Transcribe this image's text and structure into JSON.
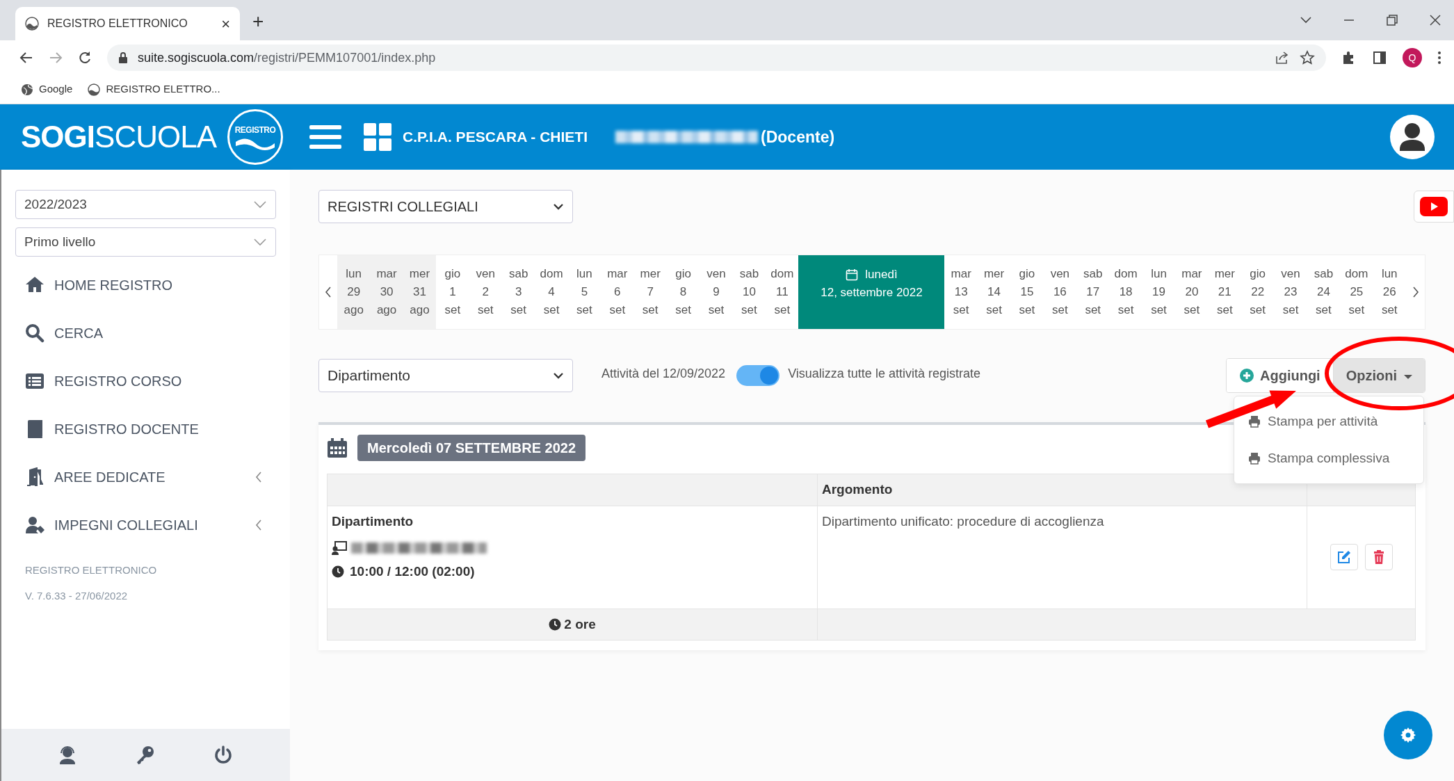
{
  "browser": {
    "tab_title": "REGISTRO ELETTRONICO",
    "tab_close": "×",
    "new_tab": "+",
    "url_host": "suite.sogiscuola.com",
    "url_path": "/registri/PEMM107001/index.php",
    "profile_initial": "Q",
    "bookmarks": [
      {
        "label": "Google",
        "kind": "globe"
      },
      {
        "label": "REGISTRO ELETTRO...",
        "kind": "site"
      }
    ]
  },
  "header": {
    "logo": "**SOGI**SCUOLA",
    "logo_badge": "REGISTRO",
    "school": "C.P.I.A. PESCARA - CHIETI",
    "role": "(Docente)"
  },
  "sidebar": {
    "selects": [
      {
        "value": "2022/2023"
      },
      {
        "value": "Primo livello"
      }
    ],
    "items": [
      {
        "label": "HOME REGISTRO",
        "expandable": false
      },
      {
        "label": "CERCA",
        "expandable": false
      },
      {
        "label": "REGISTRO CORSO",
        "expandable": false
      },
      {
        "label": "REGISTRO DOCENTE",
        "expandable": false
      },
      {
        "label": "AREE DEDICATE",
        "expandable": true
      },
      {
        "label": "IMPEGNI COLLEGIALI",
        "expandable": true
      }
    ],
    "footer_title": "REGISTRO ELETTRONICO",
    "version": "V. 7.6.33 - 27/06/2022"
  },
  "main": {
    "register_select": "REGISTRI COLLEGIALI",
    "days": [
      {
        "weekday": "lun",
        "day": "29",
        "month": "ago",
        "muted": true,
        "selected": false
      },
      {
        "weekday": "mar",
        "day": "30",
        "month": "ago",
        "muted": true,
        "selected": false
      },
      {
        "weekday": "mer",
        "day": "31",
        "month": "ago",
        "muted": true,
        "selected": false
      },
      {
        "weekday": "gio",
        "day": "1",
        "month": "set",
        "muted": false,
        "selected": false
      },
      {
        "weekday": "ven",
        "day": "2",
        "month": "set",
        "muted": false,
        "selected": false
      },
      {
        "weekday": "sab",
        "day": "3",
        "month": "set",
        "muted": false,
        "selected": false
      },
      {
        "weekday": "dom",
        "day": "4",
        "month": "set",
        "muted": false,
        "selected": false
      },
      {
        "weekday": "lun",
        "day": "5",
        "month": "set",
        "muted": false,
        "selected": false
      },
      {
        "weekday": "mar",
        "day": "6",
        "month": "set",
        "muted": false,
        "selected": false
      },
      {
        "weekday": "mer",
        "day": "7",
        "month": "set",
        "muted": false,
        "selected": false
      },
      {
        "weekday": "gio",
        "day": "8",
        "month": "set",
        "muted": false,
        "selected": false
      },
      {
        "weekday": "ven",
        "day": "9",
        "month": "set",
        "muted": false,
        "selected": false
      },
      {
        "weekday": "sab",
        "day": "10",
        "month": "set",
        "muted": false,
        "selected": false
      },
      {
        "weekday": "dom",
        "day": "11",
        "month": "set",
        "muted": false,
        "selected": false
      },
      {
        "weekday": "lunedì",
        "date": "12, settembre 2022",
        "muted": false,
        "selected": true
      },
      {
        "weekday": "mar",
        "day": "13",
        "month": "set",
        "muted": false,
        "selected": false
      },
      {
        "weekday": "mer",
        "day": "14",
        "month": "set",
        "muted": false,
        "selected": false
      },
      {
        "weekday": "gio",
        "day": "15",
        "month": "set",
        "muted": false,
        "selected": false
      },
      {
        "weekday": "ven",
        "day": "16",
        "month": "set",
        "muted": false,
        "selected": false
      },
      {
        "weekday": "sab",
        "day": "17",
        "month": "set",
        "muted": false,
        "selected": false
      },
      {
        "weekday": "dom",
        "day": "18",
        "month": "set",
        "muted": false,
        "selected": false
      },
      {
        "weekday": "lun",
        "day": "19",
        "month": "set",
        "muted": false,
        "selected": false
      },
      {
        "weekday": "mar",
        "day": "20",
        "month": "set",
        "muted": false,
        "selected": false
      },
      {
        "weekday": "mer",
        "day": "21",
        "month": "set",
        "muted": false,
        "selected": false
      },
      {
        "weekday": "gio",
        "day": "22",
        "month": "set",
        "muted": false,
        "selected": false
      },
      {
        "weekday": "ven",
        "day": "23",
        "month": "set",
        "muted": false,
        "selected": false
      },
      {
        "weekday": "sab",
        "day": "24",
        "month": "set",
        "muted": false,
        "selected": false
      },
      {
        "weekday": "dom",
        "day": "25",
        "month": "set",
        "muted": false,
        "selected": false
      },
      {
        "weekday": "lun",
        "day": "26",
        "month": "set",
        "muted": false,
        "selected": false
      }
    ],
    "activity_select": "Dipartimento",
    "activity_label": "Attività del 12/09/2022",
    "show_all": {
      "on": true,
      "label": "Visualizza tutte le attività registrate"
    },
    "add_button": "Aggiungi",
    "options_button": {
      "label": "Opzioni",
      "expanded": true
    },
    "options_menu": [
      "Stampa per attività",
      "Stampa complessiva"
    ],
    "day_card": {
      "date": "Mercoledì 07 SETTEMBRE 2022",
      "topic_header": "Argomento",
      "rows": [
        {
          "activity": "Dipartimento",
          "time": "10:00 / 12:00 (02:00)",
          "topic": "Dipartimento unificato: procedure di accoglienza"
        }
      ],
      "total": "2 ore"
    }
  }
}
